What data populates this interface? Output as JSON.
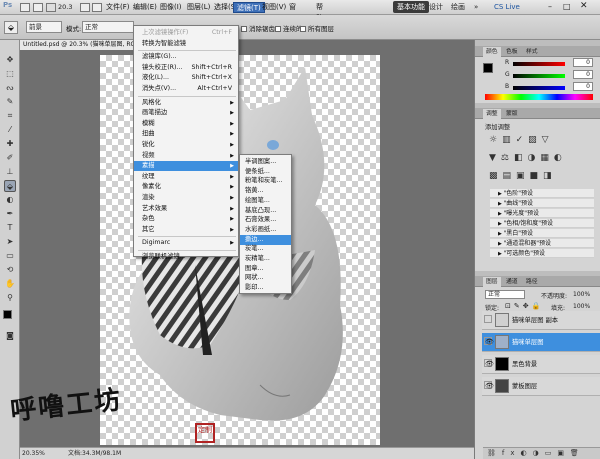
{
  "app": {
    "logo": "Ps",
    "zoom_level": "20.3"
  },
  "menubar": {
    "items": [
      "文件(F)",
      "编辑(E)",
      "图像(I)",
      "图层(L)",
      "选择(S)",
      "滤镜(T)",
      "视图(V)",
      "窗口(W)",
      "帮助(H)"
    ],
    "active_index": 5
  },
  "workspace": {
    "basic": "基本功能",
    "design": "设计",
    "painting": "绘画",
    "more": "»",
    "cslive": "CS Live"
  },
  "options": {
    "preset": "前景",
    "mode_label": "模式:",
    "mode_value": "正常",
    "antialias": "消除锯齿",
    "contiguous": "连续的",
    "all_layers": "所有图层"
  },
  "document": {
    "tab_title": "Untitled.psd @ 20.3% (猫咪单层图, RGB/8) *"
  },
  "status": {
    "zoom": "20.35%",
    "doc_info": "文档:34.3M/98.1M"
  },
  "filter_menu": {
    "items": [
      {
        "label": "上次滤镜操作(F)",
        "shortcut": "Ctrl+F",
        "disabled": true
      },
      {
        "label": "转换为智能滤镜"
      },
      {
        "label": "滤镜库(G)..."
      },
      {
        "label": "镜头校正(R)...",
        "shortcut": "Shift+Ctrl+R"
      },
      {
        "label": "液化(L)...",
        "shortcut": "Shift+Ctrl+X"
      },
      {
        "label": "消失点(V)...",
        "shortcut": "Alt+Ctrl+V"
      },
      {
        "label": "风格化",
        "submenu": true
      },
      {
        "label": "画笔描边",
        "submenu": true
      },
      {
        "label": "模糊",
        "submenu": true
      },
      {
        "label": "扭曲",
        "submenu": true
      },
      {
        "label": "锐化",
        "submenu": true
      },
      {
        "label": "视频",
        "submenu": true
      },
      {
        "label": "素描",
        "submenu": true,
        "highlighted": true
      },
      {
        "label": "纹理",
        "submenu": true
      },
      {
        "label": "像素化",
        "submenu": true
      },
      {
        "label": "渲染",
        "submenu": true
      },
      {
        "label": "艺术效果",
        "submenu": true
      },
      {
        "label": "杂色",
        "submenu": true
      },
      {
        "label": "其它",
        "submenu": true
      },
      {
        "label": "Digimarc",
        "submenu": true
      },
      {
        "label": "浏览联机滤镜..."
      }
    ]
  },
  "sketch_submenu": {
    "items": [
      "半调图案...",
      "便条纸...",
      "粉笔和炭笔...",
      "铬黄...",
      "绘图笔...",
      "基底凸现...",
      "石膏效果...",
      "水彩画纸...",
      "撕边...",
      "炭笔...",
      "炭精笔...",
      "图章...",
      "网状...",
      "影印..."
    ],
    "highlighted_index": 8
  },
  "color_panel": {
    "tabs": [
      "颜色",
      "色板",
      "样式"
    ],
    "channels": [
      "R",
      "G",
      "B"
    ],
    "values": [
      "0",
      "0",
      "0"
    ]
  },
  "adjustments_panel": {
    "tabs": [
      "调整",
      "蒙版"
    ],
    "title": "添加调整",
    "presets": [
      "\"色阶\"预设",
      "\"曲线\"预设",
      "\"曝光度\"预设",
      "\"色相/饱和度\"预设",
      "\"黑白\"预设",
      "\"通道混和器\"预设",
      "\"可选颜色\"预设"
    ]
  },
  "layers_panel": {
    "tabs": [
      "图层",
      "通道",
      "路径"
    ],
    "blend_mode": "正常",
    "opacity_label": "不透明度:",
    "opacity_value": "100%",
    "lock_label": "锁定:",
    "fill_label": "填充:",
    "fill_value": "100%",
    "layers": [
      {
        "name": "猫咪单层图 副本",
        "visible": false,
        "selected": false
      },
      {
        "name": "猫咪单层图",
        "visible": true,
        "selected": true
      },
      {
        "name": "黑色背景",
        "visible": true,
        "selected": false
      },
      {
        "name": "蒙板图层",
        "visible": true,
        "selected": false
      }
    ]
  },
  "watermark": {
    "text": "呼噜工坊",
    "seal": "定制"
  }
}
